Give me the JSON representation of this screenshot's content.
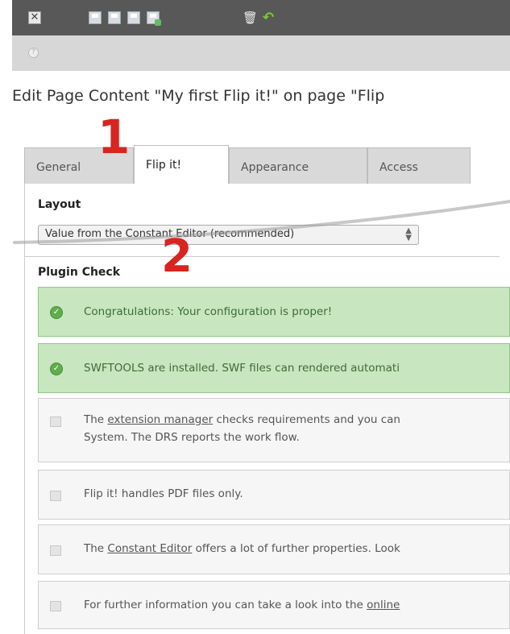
{
  "toolbar": {
    "close_glyph": "✕",
    "icons": [
      "close-icon",
      "save-icon",
      "save-and-view-icon",
      "save-and-close-icon",
      "save-and-new-icon",
      "delete-icon",
      "undo-icon"
    ]
  },
  "page": {
    "title": "Edit Page Content \"My first Flip it!\" on page \"Flip"
  },
  "tabs": [
    {
      "label": "General"
    },
    {
      "label": "Flip it!"
    },
    {
      "label": "Appearance"
    },
    {
      "label": "Access"
    }
  ],
  "annotations": {
    "one": "1",
    "two": "2"
  },
  "layout_section": {
    "label": "Layout",
    "select_value": "Value from the Constant Editor (recommended)"
  },
  "plugin_check": {
    "label": "Plugin Check",
    "messages": [
      {
        "type": "ok",
        "text": "Congratulations: Your configuration is proper!"
      },
      {
        "type": "ok",
        "text": "SWFTOOLS are installed. SWF files can rendered automati"
      },
      {
        "type": "info",
        "pre": "The ",
        "link": "extension manager",
        "post": " checks requirements and you can",
        "line2": "System. The DRS reports the work flow."
      },
      {
        "type": "info",
        "text": "Flip it! handles PDF files only."
      },
      {
        "type": "info",
        "pre": "The ",
        "link": "Constant Editor",
        "post": " offers a lot of further properties. Look"
      },
      {
        "type": "info",
        "pre": "For further information you can take a look into the ",
        "link": "online"
      }
    ]
  },
  "colors": {
    "toolbar_bg": "#585858",
    "success_bg": "#c8e6c0",
    "annotation_red": "#d9241f"
  }
}
